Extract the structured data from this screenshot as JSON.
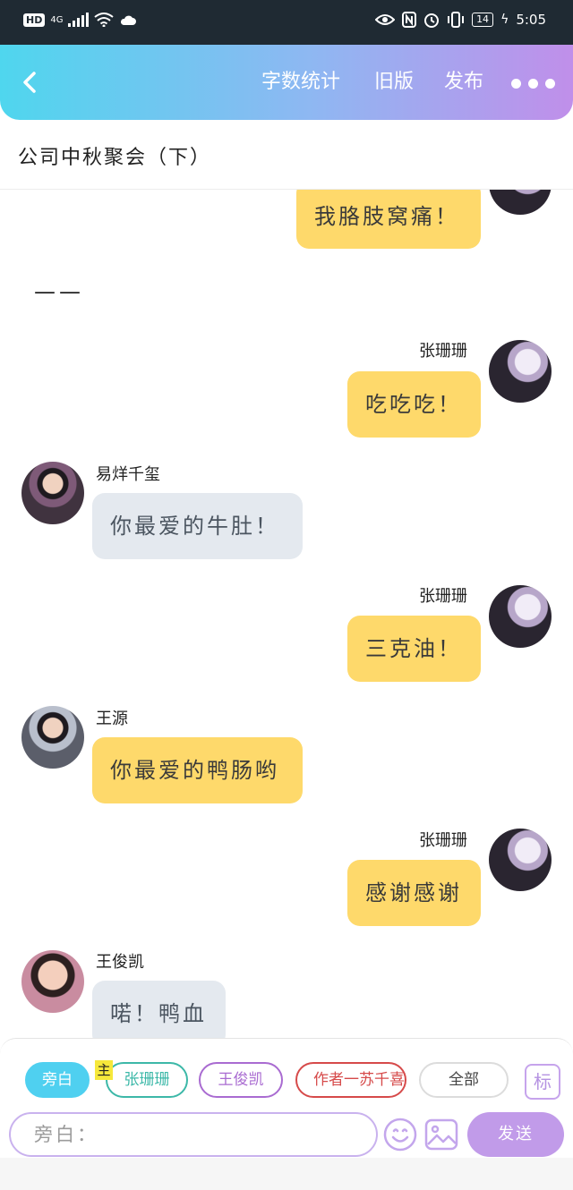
{
  "status_bar": {
    "hd": "HD",
    "net": "4G",
    "battery": "14",
    "time": "5:05"
  },
  "header": {
    "btn_wordcount": "字数统计",
    "btn_oldversion": "旧版",
    "btn_publish": "发布"
  },
  "title": "公司中秋聚会（下）",
  "messages": {
    "m1": {
      "text": "我胳肢窝痛！"
    },
    "narration": "——",
    "m2": {
      "name": "张珊珊",
      "text": "吃吃吃！"
    },
    "m3": {
      "name": "易烊千玺",
      "text": "你最爱的牛肚！"
    },
    "m4": {
      "name": "张珊珊",
      "text": "三克油！"
    },
    "m5": {
      "name": "王源",
      "text": "你最爱的鸭肠哟"
    },
    "m6": {
      "name": "张珊珊",
      "text": "感谢感谢"
    },
    "m7": {
      "name": "王俊凯",
      "text": "喏！鸭血"
    }
  },
  "bottom": {
    "role_narration": "旁白",
    "main_tag": "主",
    "role_zhang": "张珊珊",
    "role_wang": "王俊凯",
    "role_author": "作者一苏千喜",
    "role_all": "全部",
    "biao": "标",
    "input_placeholder": "旁白：",
    "send": "发送"
  },
  "colors": {
    "header_gradient": [
      "#4fd6ee",
      "#c08fea"
    ],
    "bubble_right": "#fed96b",
    "bubble_left": "#e4e9ef",
    "send_button": "#c19be9"
  }
}
